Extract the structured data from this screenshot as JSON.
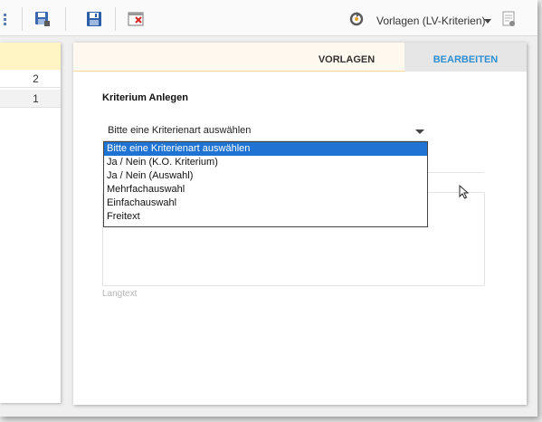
{
  "toolbar": {
    "template_selector_label": "Vorlagen (LV-Kriterien)",
    "icons": [
      "save-icon",
      "save-as-icon",
      "delete-window-icon",
      "refresh-icon",
      "settings-icon"
    ],
    "accent_color": "#1f74d3"
  },
  "left_panel": {
    "rows": [
      "2",
      "1"
    ],
    "header_color": "#fff5c4"
  },
  "main": {
    "tabs": [
      {
        "label": "VORLAGEN",
        "active": false
      },
      {
        "label": "BEARBEITEN",
        "active": true
      }
    ],
    "section_title": "Kriterium Anlegen",
    "select": {
      "value": "Bitte eine Kriterienart auswählen",
      "options": [
        "Bitte eine Kriterienart auswählen",
        "Ja / Nein (K.O. Kriterium)",
        "Ja / Nein (Auswahl)",
        "Mehrfachauswahl",
        "Einfachauswahl",
        "Freitext"
      ],
      "selected_index": 0
    },
    "langtext_label": "Langtext"
  }
}
